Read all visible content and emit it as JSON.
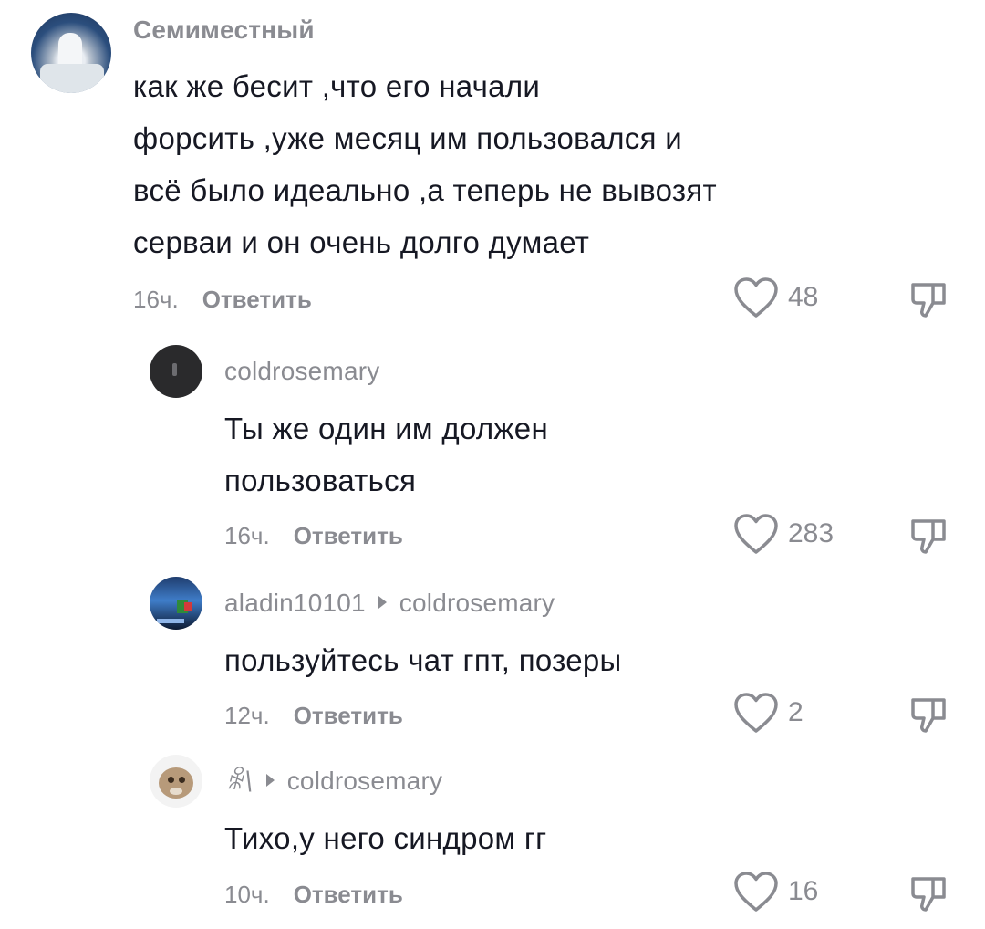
{
  "comments": [
    {
      "username": "Семиместный",
      "lines": [
        "как же бесит ,что его начали",
        "форсить ,уже месяц им пользовался и",
        "всё было идеально ,а теперь не вывозят",
        "серваи и он очень долго думает"
      ],
      "time": "16ч.",
      "reply_label": "Ответить",
      "likes": "48"
    }
  ],
  "replies": [
    {
      "username": "coldrosemary",
      "reply_to": "",
      "lines": [
        "Ты же один им должен",
        "пользоваться"
      ],
      "time": "16ч.",
      "reply_label": "Ответить",
      "likes": "283"
    },
    {
      "username": "aladin10101",
      "reply_to": "coldrosemary",
      "lines": [
        "пользуйтесь чат гпт, позеры"
      ],
      "time": "12ч.",
      "reply_label": "Ответить",
      "likes": "2"
    },
    {
      "username": "ꆜ\\",
      "reply_to": "coldrosemary",
      "lines": [
        "Тихо,у него синдром гг"
      ],
      "time": "10ч.",
      "reply_label": "Ответить",
      "likes": "16"
    }
  ],
  "icons": {
    "like": "heart-outline-icon",
    "dislike": "thumbs-down-icon",
    "reply_arrow": "triangle-right-icon"
  },
  "colors": {
    "text": "#161823",
    "muted": "#8a8b91",
    "background": "#ffffff"
  }
}
